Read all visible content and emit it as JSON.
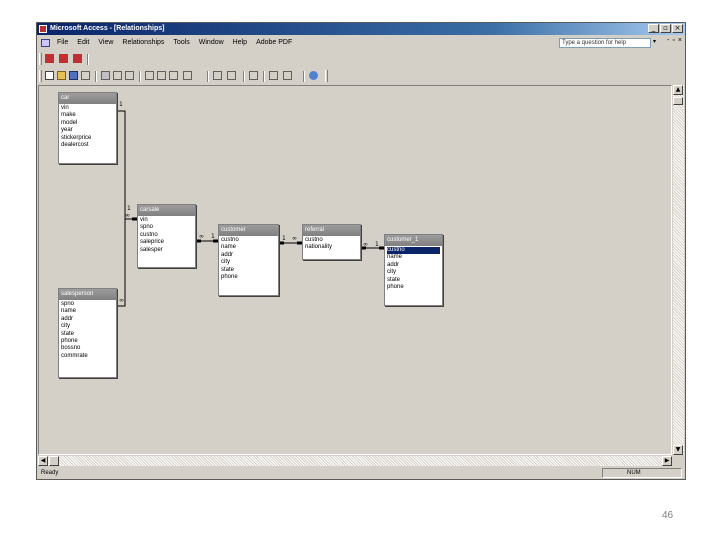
{
  "window": {
    "title": "Microsoft Access - [Relationships]",
    "controls": [
      "_",
      "▫",
      "×"
    ]
  },
  "menubar": {
    "items": [
      "File",
      "Edit",
      "View",
      "Relationships",
      "Tools",
      "Window",
      "Help",
      "Adobe PDF"
    ],
    "help_placeholder": "Type a question for help",
    "mdi_controls": [
      "-",
      "▫",
      "×"
    ]
  },
  "tables": {
    "car": {
      "name": "car",
      "fields": [
        "vin",
        "make",
        "model",
        "year",
        "stickerprice",
        "dealercost"
      ]
    },
    "carsale": {
      "name": "carsale",
      "fields": [
        "vin",
        "spno",
        "custno",
        "saleprice",
        "salesper"
      ]
    },
    "customer": {
      "name": "customer",
      "fields": [
        "custno",
        "name",
        "addr",
        "city",
        "state",
        "phone"
      ]
    },
    "referral": {
      "name": "referral",
      "fields": [
        "custno",
        "nationality"
      ]
    },
    "customer_1": {
      "name": "customer_1",
      "fields": [
        "custno",
        "name",
        "addr",
        "city",
        "state",
        "phone"
      ],
      "selected_index": 0
    },
    "salesperson": {
      "name": "salesperson",
      "fields": [
        "spno",
        "name",
        "addr",
        "city",
        "state",
        "phone",
        "bossno",
        "commrate"
      ]
    }
  },
  "relationships": {
    "car_carsale": {
      "one": "1",
      "many": "∞"
    },
    "sp_carsale": {
      "one": "1",
      "many": "∞"
    },
    "carsale_customer": {
      "many": "∞",
      "one": "1"
    },
    "customer_referral": {
      "one": "1",
      "many": "∞"
    },
    "referral_customer1": {
      "many": "∞",
      "one": "1"
    }
  },
  "statusbar": {
    "left": "Ready",
    "right": "NUM"
  },
  "page_number": "46"
}
